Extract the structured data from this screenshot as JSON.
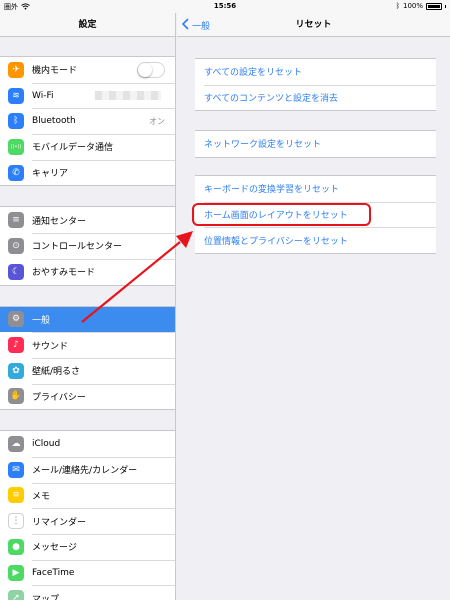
{
  "status_bar": {
    "carrier": "圏外",
    "time": "15:56",
    "battery": "100%"
  },
  "sidebar": {
    "title": "設定",
    "groups": [
      [
        {
          "label": "機内モード",
          "icon": "airplane-icon",
          "color": "#ff9500",
          "glyph": "✈"
        },
        {
          "label": "Wi-Fi",
          "icon": "wifi-icon",
          "color": "#2d7ff9",
          "glyph": "≋"
        },
        {
          "label": "Bluetooth",
          "icon": "bluetooth-icon",
          "color": "#2d7ff9",
          "glyph": "ᛒ",
          "value": "オン"
        },
        {
          "label": "モバイルデータ通信",
          "icon": "cellular-icon",
          "color": "#4cd964",
          "glyph": "((•))"
        },
        {
          "label": "キャリア",
          "icon": "phone-icon",
          "color": "#2d7ff9",
          "glyph": "✆"
        }
      ],
      [
        {
          "label": "通知センター",
          "icon": "notification-center-icon",
          "color": "#8e8e93",
          "glyph": "≡"
        },
        {
          "label": "コントロールセンター",
          "icon": "control-center-icon",
          "color": "#8e8e93",
          "glyph": "⊙"
        },
        {
          "label": "おやすみモード",
          "icon": "moon-icon",
          "color": "#5856d6",
          "glyph": "☾"
        }
      ],
      [
        {
          "label": "一般",
          "icon": "gear-icon",
          "color": "#8e8e93",
          "glyph": "⚙",
          "selected": true
        },
        {
          "label": "サウンド",
          "icon": "sound-icon",
          "color": "#ff2d55",
          "glyph": "♪"
        },
        {
          "label": "壁紙/明るさ",
          "icon": "wallpaper-icon",
          "color": "#34aadc",
          "glyph": "✿"
        },
        {
          "label": "プライバシー",
          "icon": "hand-icon",
          "color": "#8e8e93",
          "glyph": "✋"
        }
      ],
      [
        {
          "label": "iCloud",
          "icon": "icloud-icon",
          "color": "#8e8e93",
          "glyph": "☁"
        },
        {
          "label": "メール/連絡先/カレンダー",
          "icon": "mail-icon",
          "color": "#2d7ff9",
          "glyph": "✉"
        },
        {
          "label": "メモ",
          "icon": "notes-icon",
          "color": "#ffcc00",
          "glyph": "≡"
        },
        {
          "label": "リマインダー",
          "icon": "reminders-icon",
          "color": "#ffffff",
          "glyph": "⋮"
        },
        {
          "label": "メッセージ",
          "icon": "messages-icon",
          "color": "#4cd964",
          "glyph": "●"
        },
        {
          "label": "FaceTime",
          "icon": "facetime-icon",
          "color": "#4cd964",
          "glyph": "▶"
        },
        {
          "label": "マップ",
          "icon": "maps-icon",
          "color": "#8fd3a4",
          "glyph": "➚"
        }
      ]
    ]
  },
  "main": {
    "back_label": "一般",
    "title": "リセット",
    "group1": [
      "すべての設定をリセット",
      "すべてのコンテンツと設定を消去"
    ],
    "group2": [
      "ネットワーク設定をリセット"
    ],
    "group3": [
      "キーボードの変換学習をリセット",
      "ホーム画面のレイアウトをリセット",
      "位置情報とプライバシーをリセット"
    ]
  },
  "colors": {
    "accent": "#2c7ef5",
    "selected": "#3b8cee",
    "annotation": "#e8141b"
  }
}
